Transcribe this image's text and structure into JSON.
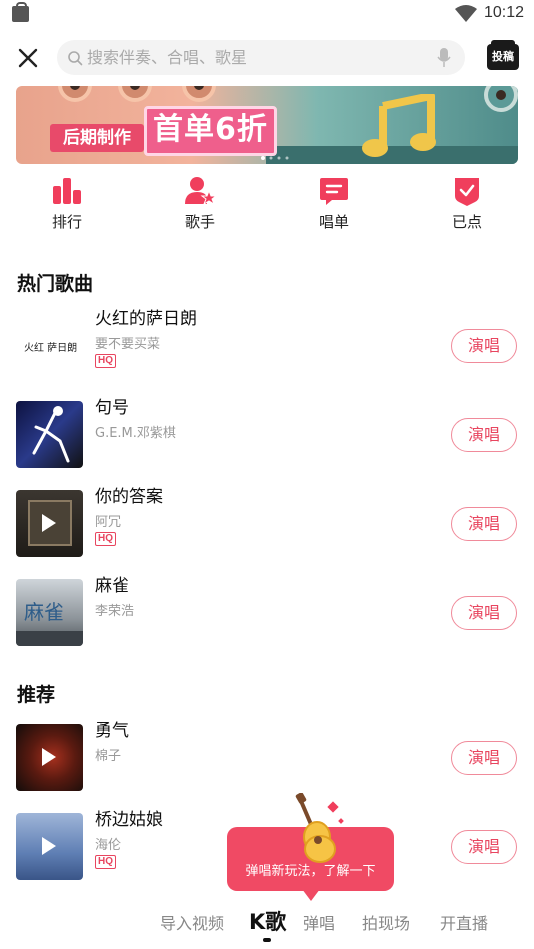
{
  "status_bar": {
    "time": "10:12",
    "icons": [
      "shopping-bag-icon",
      "wifi-icon",
      "battery-icon"
    ]
  },
  "header": {
    "close_icon": "close-icon",
    "search_placeholder": "搜索伴奏、合唱、歌星",
    "mic_icon": "microphone-icon",
    "submit_label": "投稿"
  },
  "banner": {
    "tag": "后期制作",
    "headline": "首单6折"
  },
  "quick_nav": [
    {
      "label": "排行",
      "icon": "ranking-icon"
    },
    {
      "label": "歌手",
      "icon": "singer-icon"
    },
    {
      "label": "唱单",
      "icon": "song-list-icon"
    },
    {
      "label": "已点",
      "icon": "ordered-icon"
    }
  ],
  "sections": {
    "hot_title": "热门歌曲",
    "recommend_title": "推荐"
  },
  "hot_songs": [
    {
      "title": "火红的萨日朗",
      "artist": "要不要买菜",
      "hq": "HQ",
      "cover_text": "火红 萨日朗"
    },
    {
      "title": "句号",
      "artist": "G.E.M.邓紫棋",
      "hq": ""
    },
    {
      "title": "你的答案",
      "artist": "阿冗",
      "hq": "HQ"
    },
    {
      "title": "麻雀",
      "artist": "李荣浩",
      "hq": "",
      "cover_text": "麻雀"
    }
  ],
  "recommended_songs": [
    {
      "title": "勇气",
      "artist": "棉子",
      "hq": ""
    },
    {
      "title": "桥边姑娘",
      "artist": "海伦",
      "hq": "HQ"
    }
  ],
  "sing_label": "演唱",
  "promo": {
    "text": "弹唱新玩法，了解一下"
  },
  "tabs": [
    {
      "label": "导入视频"
    },
    {
      "label": "K歌"
    },
    {
      "label": "弹唱"
    },
    {
      "label": "拍现场"
    },
    {
      "label": "开直播"
    }
  ],
  "colors": {
    "accent": "#e8455f",
    "promo": "#f04a64"
  }
}
